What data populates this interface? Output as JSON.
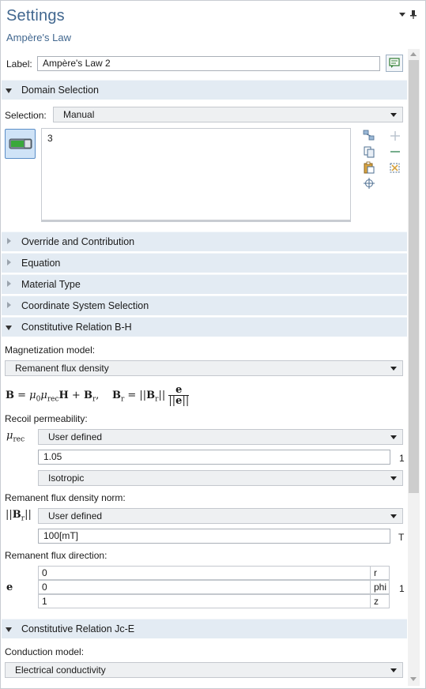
{
  "header": {
    "title": "Settings",
    "subtitle": "Ampère's Law"
  },
  "label_row": {
    "label": "Label:",
    "value": "Ampère's Law 2"
  },
  "domain_selection": {
    "title": "Domain Selection",
    "selection_label": "Selection:",
    "selection_value": "Manual",
    "selected_domains": "3"
  },
  "collapsed_sections": [
    {
      "title": "Override and Contribution"
    },
    {
      "title": "Equation"
    },
    {
      "title": "Material Type"
    },
    {
      "title": "Coordinate System Selection"
    }
  ],
  "constitutive_bh": {
    "title": "Constitutive Relation B-H",
    "magnetization_label": "Magnetization model:",
    "magnetization_value": "Remanent flux density",
    "recoil_label": "Recoil permeability:",
    "mu_rec_mode": "User defined",
    "mu_rec_value": "1.05",
    "mu_rec_unit": "1",
    "mu_rec_type": "Isotropic",
    "br_norm_label": "Remanent flux density norm:",
    "br_mode": "User defined",
    "br_value": "100[mT]",
    "br_unit": "T",
    "direction_label": "Remanent flux direction:",
    "direction_symbol": "e",
    "direction_unit": "1",
    "direction_rows": [
      {
        "value": "0",
        "component": "r"
      },
      {
        "value": "0",
        "component": "phi"
      },
      {
        "value": "1",
        "component": "z"
      }
    ]
  },
  "constitutive_jce": {
    "title": "Constitutive Relation Jc-E",
    "conduction_label": "Conduction model:",
    "conduction_value": "Electrical conductivity"
  },
  "colors": {
    "title": "#41678f",
    "section_bg": "#e3ebf3",
    "selection_button": "#cfe3f7",
    "toggle_green": "#3aa83a"
  }
}
